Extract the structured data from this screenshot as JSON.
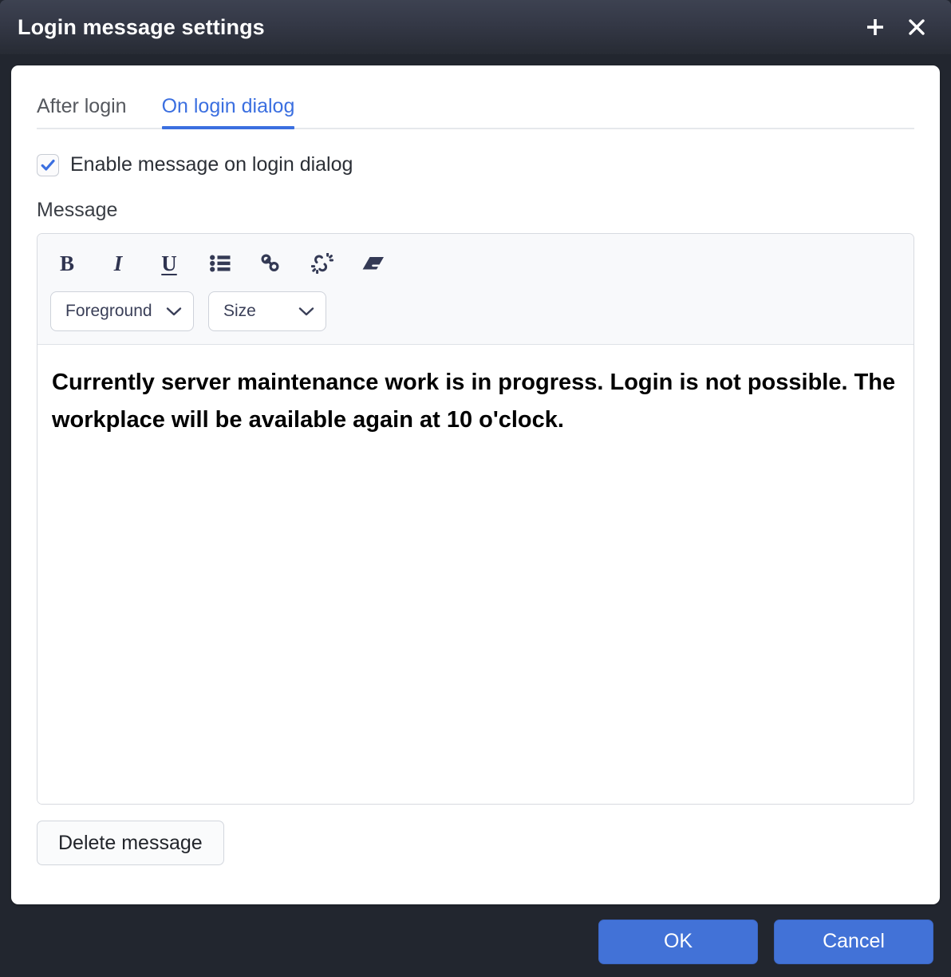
{
  "window": {
    "title": "Login message settings",
    "add_icon": "plus-icon",
    "close_icon": "close-icon",
    "titlebar_gradient_top": "#3d4251",
    "titlebar_gradient_bottom": "#272b34",
    "frame_color": "#22262f"
  },
  "tabs": [
    {
      "label": "After login",
      "active": false
    },
    {
      "label": "On login dialog",
      "active": true
    }
  ],
  "accent_color": "#3b6fe0",
  "enable_checkbox": {
    "label": "Enable message on login dialog",
    "checked": true,
    "check_color": "#3b6fe0"
  },
  "message_field": {
    "label": "Message",
    "toolbar": {
      "icons": [
        {
          "name": "bold-icon",
          "glyph": "B",
          "title": "Bold"
        },
        {
          "name": "italic-icon",
          "glyph": "I",
          "title": "Italic"
        },
        {
          "name": "underline-icon",
          "glyph": "U",
          "title": "Underline"
        },
        {
          "name": "bullet-list-icon",
          "glyph": "",
          "title": "Bullet list"
        },
        {
          "name": "link-icon",
          "glyph": "",
          "title": "Insert link"
        },
        {
          "name": "unlink-icon",
          "glyph": "",
          "title": "Remove link"
        },
        {
          "name": "eraser-icon",
          "glyph": "",
          "title": "Clear formatting"
        }
      ],
      "icon_color": "#2f3450",
      "selects": [
        {
          "name": "foreground-select",
          "label": "Foreground"
        },
        {
          "name": "size-select",
          "label": "Size"
        }
      ]
    },
    "content": "Currently server maintenance work is in progress. Login is not possible. The workplace will be available again at 10 o'clock."
  },
  "delete_button": {
    "label": "Delete message"
  },
  "footer": {
    "ok_label": "OK",
    "cancel_label": "Cancel",
    "button_color": "#4272d7"
  }
}
